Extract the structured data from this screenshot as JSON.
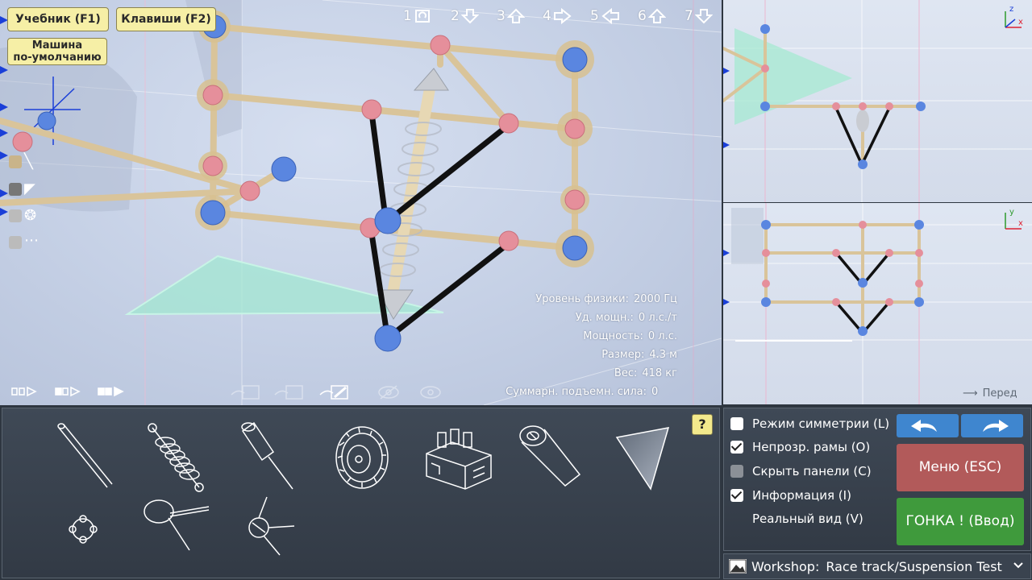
{
  "top_buttons": {
    "tutorial": "Учебник (F1)",
    "keys": "Клавиши (F2)",
    "default_car_line1": "Машина",
    "default_car_line2": "по-умолчанию"
  },
  "view_buttons": [
    {
      "num": "1",
      "icon": "rotate-view-icon"
    },
    {
      "num": "2",
      "icon": "arrow-down-icon"
    },
    {
      "num": "3",
      "icon": "arrow-up-icon"
    },
    {
      "num": "4",
      "icon": "arrow-right-icon"
    },
    {
      "num": "5",
      "icon": "arrow-left-icon"
    },
    {
      "num": "6",
      "icon": "arrow-up-icon"
    },
    {
      "num": "7",
      "icon": "arrow-down-icon"
    }
  ],
  "info": {
    "physics_label": "Уровень физики:",
    "physics_value": "2000 Гц",
    "specific_power_label": "Уд. мощн.:",
    "specific_power_value": "0 л.с./т",
    "power_label": "Мощность:",
    "power_value": "0 л.с.",
    "size_label": "Размер:",
    "size_value": "4.3 м",
    "weight_label": "Вес:",
    "weight_value": "418 кг",
    "lift_label": "Суммарн. подъемн. сила:",
    "lift_value": "0"
  },
  "front_label": "Перед",
  "help_label": "?",
  "parts": [
    "beam-part",
    "spring-part",
    "shock-absorber-part",
    "wheel-part",
    "engine-part",
    "thruster-part",
    "wing-panel-part",
    "node-part",
    "hinge-part",
    "joint-part"
  ],
  "settings": {
    "options": [
      {
        "label": "Режим симметрии (L)",
        "state": "off"
      },
      {
        "label": "Непрозр. рамы (O)",
        "state": "on"
      },
      {
        "label": "Скрыть панели (C)",
        "state": "disabled"
      },
      {
        "label": "Информация (I)",
        "state": "on"
      },
      {
        "label": "Реальный вид (V)",
        "state": "none"
      }
    ],
    "menu_label": "Меню (ESC)",
    "race_label": "ГОНКА ! (Ввод)"
  },
  "workshop": {
    "prefix": "Workshop:",
    "track": "Race track/Suspension Test"
  },
  "colors": {
    "beam": "#d9c49a",
    "node_pink": "#e58f9b",
    "node_blue": "#5a86e0",
    "menu": "#b25a5a",
    "race": "#3f9a3c",
    "undo": "#3f86cf"
  }
}
